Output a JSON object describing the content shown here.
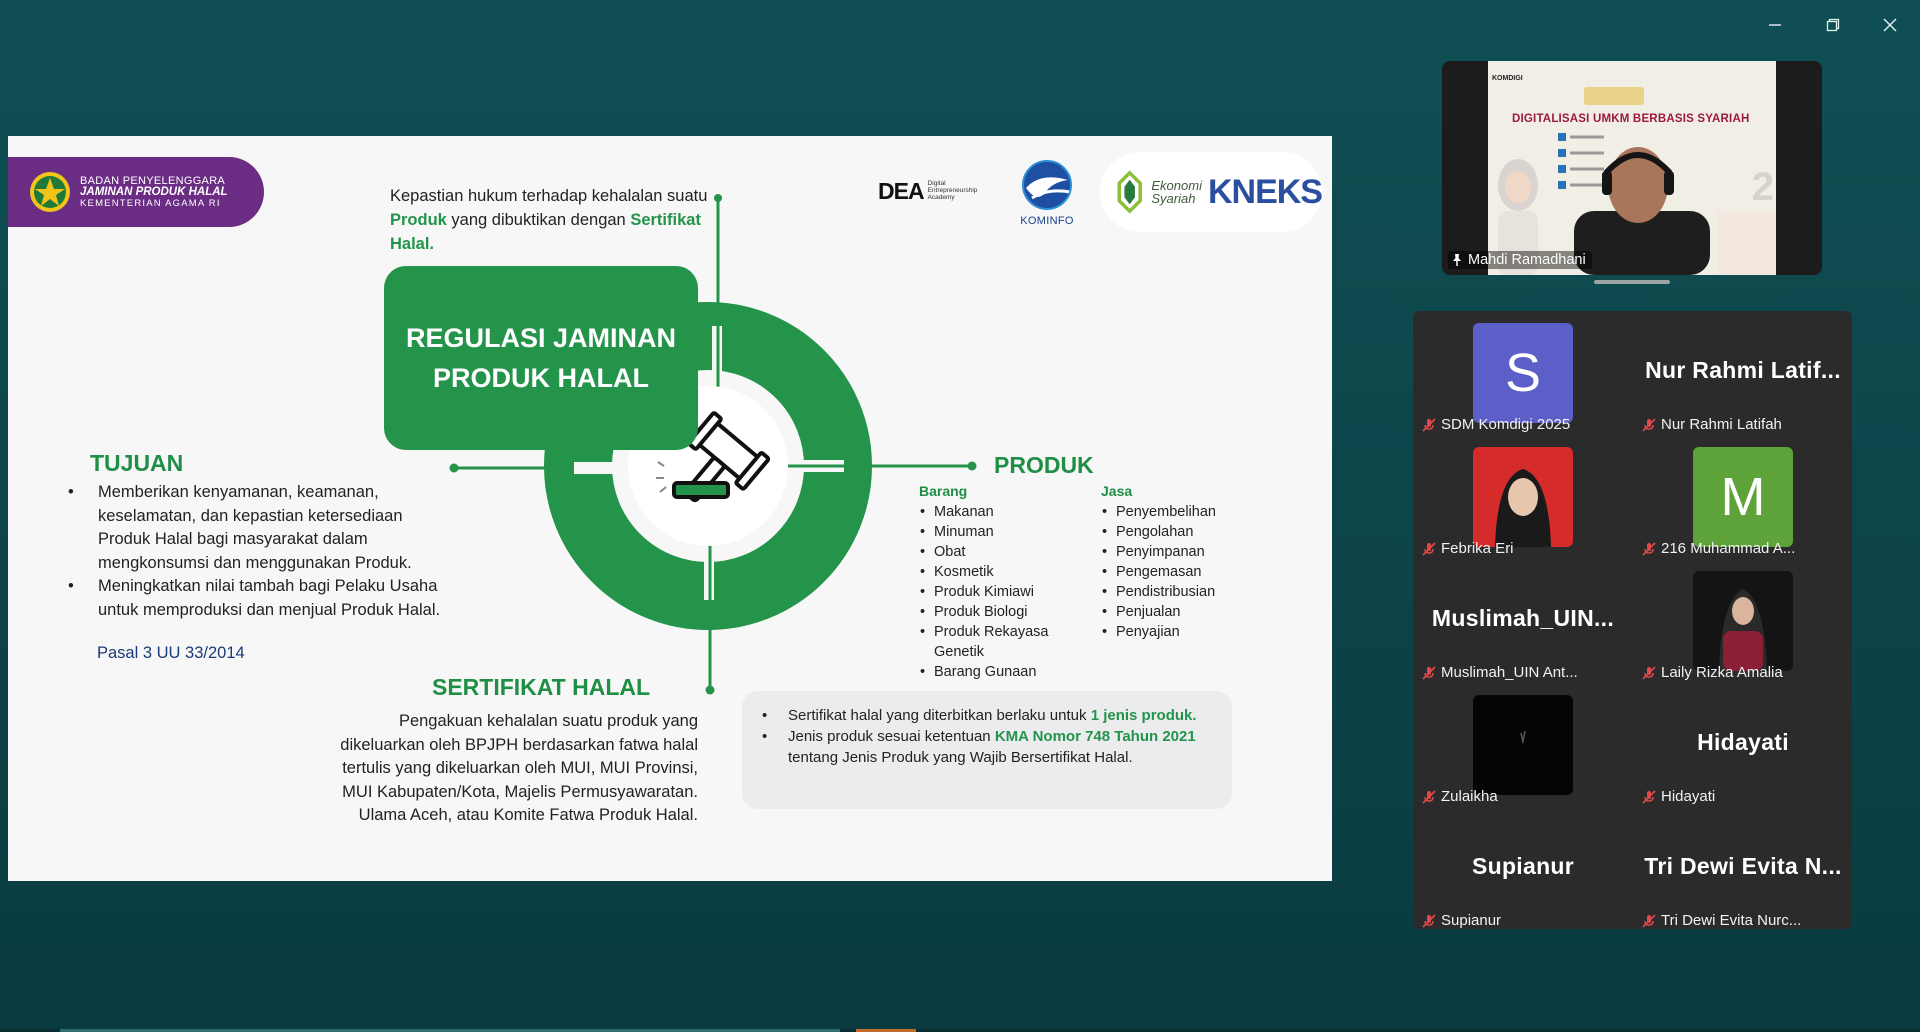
{
  "slide": {
    "bpjph": {
      "line1": "BADAN PENYELENGGARA",
      "line2": "JAMINAN PRODUK HALAL",
      "line3": "KEMENTERIAN AGAMA RI"
    },
    "logos": {
      "dea_big": "DEA",
      "dea_small1": "Digital",
      "dea_small2": "Entrepreneurship",
      "dea_small3": "Academy",
      "kominfo": "KOMINFO",
      "kneks_es1": "Ekonomi",
      "kneks_es2": "Syariah",
      "kneks_big": "KNEKS"
    },
    "top_caption": {
      "part1": "Kepastian hukum terhadap kehalalan suatu ",
      "produk": "Produk",
      "part2": " yang dibuktikan dengan ",
      "sertifikat": "Sertifikat Halal."
    },
    "title": "REGULASI JAMINAN PRODUK HALAL",
    "tujuan": {
      "heading": "TUJUAN",
      "items": [
        "Memberikan kenyamanan, keamanan, keselamatan, dan kepastian ketersediaan Produk Halal bagi masyarakat dalam mengkonsumsi dan menggunakan Produk.",
        "Meningkatkan nilai tambah bagi Pelaku Usaha untuk memproduksi dan menjual Produk Halal."
      ],
      "pasal": "Pasal 3 UU 33/2014"
    },
    "produk": {
      "heading": "PRODUK",
      "barang_heading": "Barang",
      "barang": [
        "Makanan",
        "Minuman",
        "Obat",
        "Kosmetik",
        "Produk Kimiawi",
        "Produk Biologi",
        "Produk Rekayasa Genetik",
        "Barang Gunaan"
      ],
      "jasa_heading": "Jasa",
      "jasa": [
        "Penyembelihan",
        "Pengolahan",
        "Penyimpanan",
        "Pengemasan",
        "Pendistribusian",
        "Penjualan",
        "Penyajian"
      ]
    },
    "sertifikat": {
      "heading": "SERTIFIKAT HALAL",
      "paragraph": "Pengakuan kehalalan suatu produk yang dikeluarkan oleh BPJPH berdasarkan fatwa halal tertulis yang dikeluarkan oleh MUI, MUI Provinsi, MUI Kabupaten/Kota, Majelis Permusyawaratan. Ulama Aceh, atau Komite Fatwa Produk Halal."
    },
    "notes": {
      "n1_pre": "Sertifikat halal yang diterbitkan berlaku untuk ",
      "n1_bold": "1 jenis produk.",
      "n2_pre": "Jenis produk sesuai ketentuan ",
      "n2_bold": "KMA Nomor 748 Tahun 2021",
      "n2_post": " tentang Jenis Produk yang Wajib Bersertifikat Halal."
    }
  },
  "speaker": {
    "name": "Mahdi Ramadhani",
    "video_title": "DIGITALISASI UMKM BERBASIS SYARIAH",
    "video_brand": "KOMDIGI",
    "video_big": "2"
  },
  "participants": [
    {
      "label": "SDM Komdigi 2025",
      "avatar_letter": "S",
      "avatar_color": "#5b5fc7",
      "type": "letter"
    },
    {
      "label": "Nur Rahmi Latifah",
      "big_name": "Nur Rahmi Latif...",
      "type": "name"
    },
    {
      "label": "Febrika Eri",
      "type": "photo-red"
    },
    {
      "label": "216 Muhammad A...",
      "avatar_letter": "M",
      "avatar_color": "#5ea33a",
      "type": "letter"
    },
    {
      "label": "Muslimah_UIN Ant...",
      "big_name": "Muslimah_UIN...",
      "type": "name"
    },
    {
      "label": "Laily Rizka Amalia",
      "type": "photo-dark"
    },
    {
      "label": "Zulaikha",
      "type": "photo-black"
    },
    {
      "label": "Hidayati",
      "big_name": "Hidayati",
      "type": "name"
    },
    {
      "label": "Supianur",
      "big_name": "Supianur",
      "type": "name"
    },
    {
      "label": "Tri Dewi Evita Nurc...",
      "big_name": "Tri Dewi Evita N...",
      "type": "name"
    }
  ],
  "colors": {
    "green": "#23944a",
    "purple": "#6b2c84",
    "navy": "#1b3a78",
    "background": "#0f4f54"
  }
}
